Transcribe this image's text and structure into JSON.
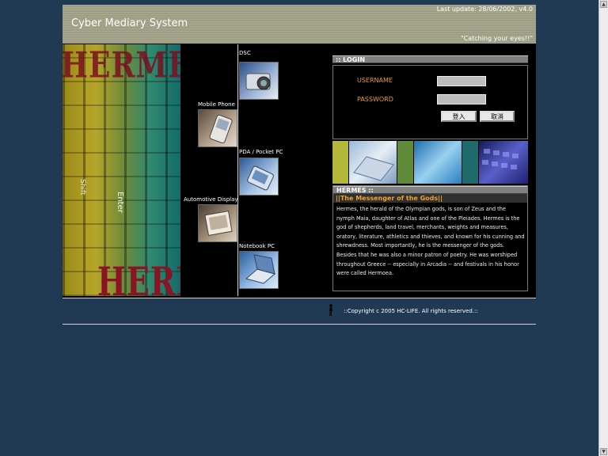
{
  "header": {
    "title": "Cyber Mediary System",
    "last_update": "Last update: 28/06/2002, v4.0",
    "slogan": "\"Catching your eyes!!\""
  },
  "hero": {
    "top_word": "HERMES",
    "bottom_word": "HERMES",
    "key_enter": "Enter",
    "key_shift": "Shift"
  },
  "devices": [
    {
      "label": "DSC",
      "icon": "camera-icon"
    },
    {
      "label": "Mobile Phone",
      "icon": "mobile-phone-icon"
    },
    {
      "label": "PDA / Pocket PC",
      "icon": "pda-icon"
    },
    {
      "label": "Automotive Display",
      "icon": "automotive-display-icon"
    },
    {
      "label": "Notebook PC",
      "icon": "notebook-icon"
    }
  ],
  "login": {
    "heading": ":: LOGIN",
    "username_label": "USERNAME",
    "password_label": "PASSWORD",
    "username_value": "",
    "password_value": "",
    "submit_label": "登入",
    "cancel_label": "取消"
  },
  "hermes": {
    "heading": "HERMES ::",
    "subtitle": "||The Messenger of the Gods||",
    "description": "Hermes, the herald of the Olympian gods, is son of Zeus and the nymph Maia, daughter of Atlas and one of the Pleiades. Hermes is the god of shepherds, land travel, merchants, weights and measures, oratory, literature, athletics and thieves, and known for his cunning and shrewdness. Most importantly, he is the messenger of the gods. Besides that he was also a minor patron of poetry. He was worshiped throughout Greece -- especially in Arcadia -- and festivals in his honor were called Hermoea."
  },
  "footer": {
    "copyright": "::Copyright c 2005 HC-LIFE. All rights reserved.::"
  },
  "colors": {
    "background": "#1f3a52",
    "header": "#9e9e84",
    "login_label": "#e89b3c",
    "subtitle_text": "#f0a030"
  }
}
